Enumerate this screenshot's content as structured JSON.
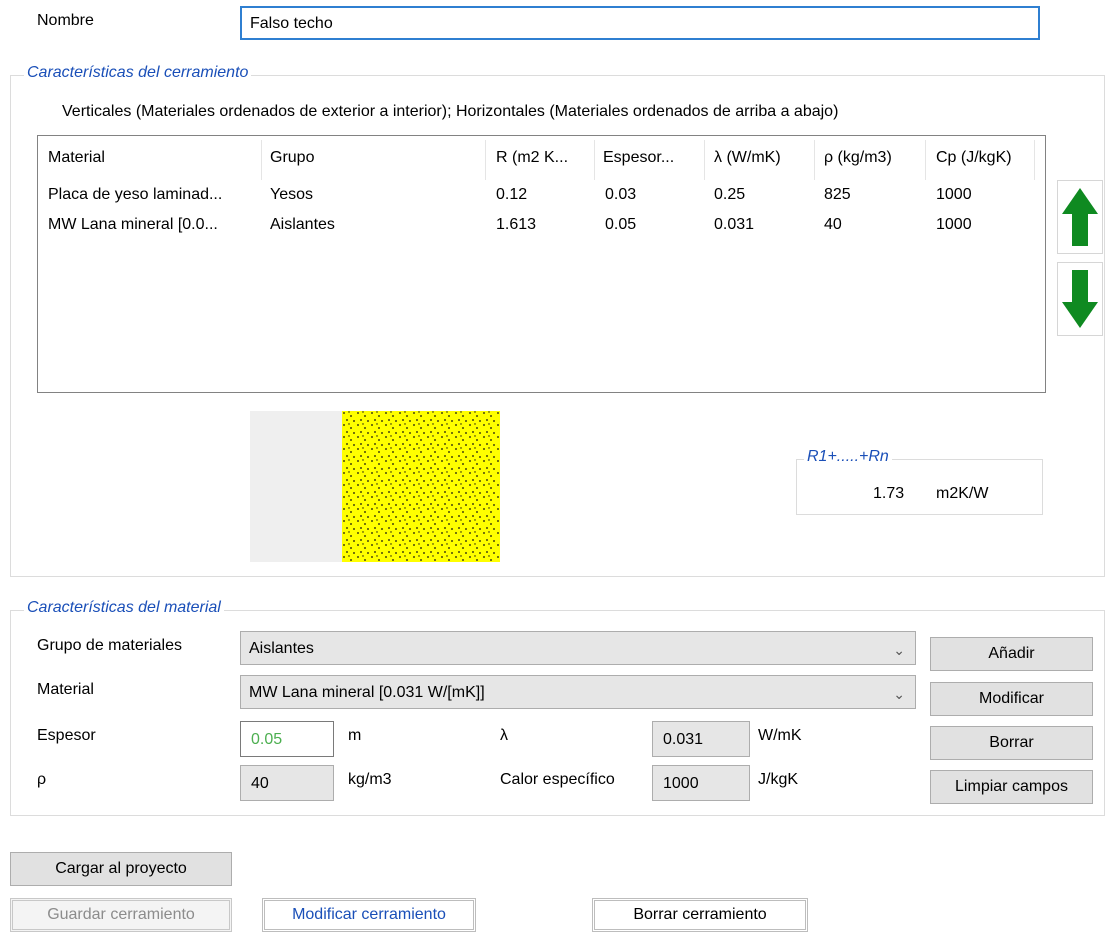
{
  "nombre": {
    "label": "Nombre",
    "value": "Falso techo"
  },
  "cerramiento": {
    "title": "Características del cerramiento",
    "subtitle": "Verticales (Materiales ordenados de exterior a interior);  Horizontales (Materiales ordenados de arriba a abajo)",
    "columns": [
      "Material",
      "Grupo",
      "R (m2 K...",
      "Espesor...",
      "λ (W/mK)",
      "ρ (kg/m3)",
      "Cp (J/kgK)"
    ],
    "rows": [
      [
        "Placa de yeso laminad...",
        "Yesos",
        "0.12",
        "0.03",
        "0.25",
        "825",
        "1000"
      ],
      [
        "MW Lana mineral [0.0...",
        "Aislantes",
        "1.613",
        "0.05",
        "0.031",
        "40",
        "1000"
      ]
    ],
    "layers": [
      {
        "material": "Placa de yeso",
        "color": "#efefef",
        "thickness": 0.03
      },
      {
        "material": "MW Lana mineral",
        "color": "#ffff00",
        "thickness": 0.05
      }
    ],
    "rsum_title": "R1+.....+Rn",
    "rsum_value": "1.73",
    "rsum_unit": "m2K/W"
  },
  "material": {
    "title": "Características del material",
    "grupo_label": "Grupo de materiales",
    "grupo_value": "Aislantes",
    "material_label": "Material",
    "material_value": "MW Lana mineral [0.031 W/[mK]]",
    "espesor_label": "Espesor",
    "espesor_value": "0.05",
    "espesor_unit": "m",
    "lambda_label": "λ",
    "lambda_value": "0.031",
    "lambda_unit": "W/mK",
    "rho_label": "ρ",
    "rho_value": "40",
    "rho_unit": "kg/m3",
    "cp_label": "Calor específico",
    "cp_value": "1000",
    "cp_unit": "J/kgK",
    "buttons": {
      "add": "Añadir",
      "modify": "Modificar",
      "delete": "Borrar",
      "clear": "Limpiar campos"
    }
  },
  "actions": {
    "load": "Cargar al proyecto",
    "save": "Guardar cerramiento",
    "modify": "Modificar cerramiento",
    "delete": "Borrar cerramiento"
  },
  "colors": {
    "accent_blue": "#1a4fb8",
    "arrow_green": "#0f8a21",
    "espesor_text": "#4caf50",
    "insulation": "#ffff00"
  },
  "icons": {
    "up": "arrow-up-icon",
    "down": "arrow-down-icon",
    "dropdown": "chevron-down-icon"
  }
}
